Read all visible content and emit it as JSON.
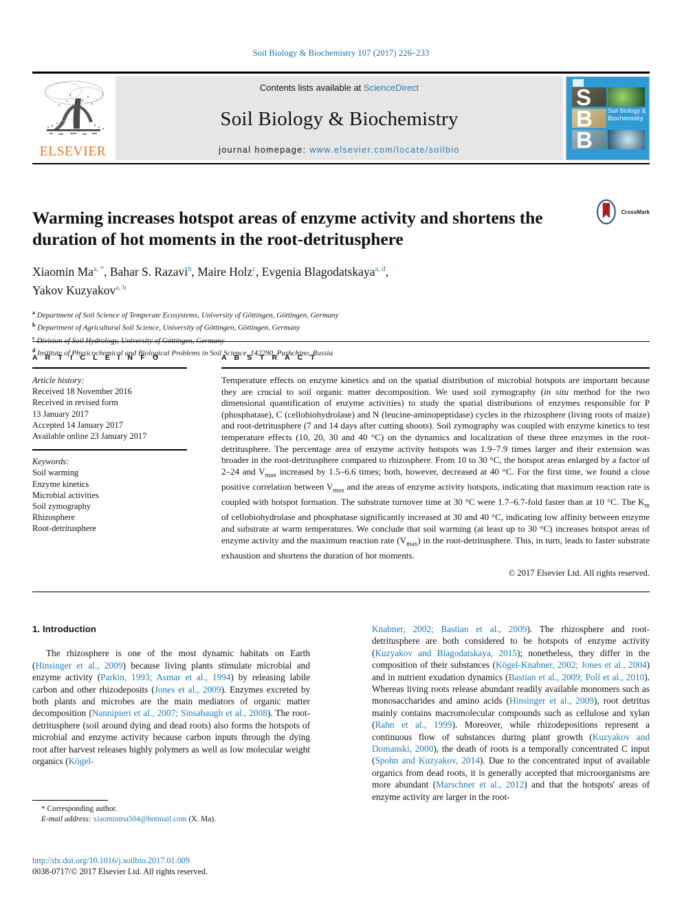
{
  "running_head": "Soil Biology & Biochemistry 107 (2017) 226–233",
  "masthead": {
    "contents_prefix": "Contents lists available at ",
    "sciencedirect": "ScienceDirect",
    "journal_title": "Soil Biology & Biochemistry",
    "homepage_prefix": "journal homepage: ",
    "homepage_url": "www.elsevier.com/locate/soilbio",
    "publisher": "ELSEVIER",
    "cover": {
      "letters": [
        "S",
        "B",
        "B"
      ],
      "title_line1": "Soil Biology &",
      "title_line2": "Biochemistry"
    }
  },
  "article": {
    "title": "Warming increases hotspot areas of enzyme activity and shortens the duration of hot moments in the root-detritusphere",
    "crossmark_label": "CrossMark",
    "authors_line1_parts": [
      {
        "name": "Xiaomin Ma",
        "sup": "a, *"
      },
      {
        "name": "Bahar S. Razavi",
        "sup": "b"
      },
      {
        "name": "Maire Holz",
        "sup": "c"
      },
      {
        "name": "Evgenia Blagodatskaya",
        "sup": "a, d"
      }
    ],
    "authors_line2_parts": [
      {
        "name": "Yakov Kuzyakov",
        "sup": "a, b"
      }
    ],
    "affiliations": [
      {
        "mark": "a",
        "text": "Department of Soil Science of Temperate Ecosystems, University of Göttingen, Göttingen, Germany"
      },
      {
        "mark": "b",
        "text": "Department of Agricultural Soil Science, University of Göttingen, Göttingen, Germany"
      },
      {
        "mark": "c",
        "text": "Division of Soil Hydrology, University of Göttingen, Germany"
      },
      {
        "mark": "d",
        "text": "Institute of Physicochemical and Biological Problems in Soil Science, 142290, Pushchino, Russia"
      }
    ]
  },
  "article_info": {
    "heading": "A R T I C L E  I N F O",
    "history_label": "Article history:",
    "history": [
      "Received 18 November 2016",
      "Received in revised form",
      "13 January 2017",
      "Accepted 14 January 2017",
      "Available online 23 January 2017"
    ],
    "keywords_label": "Keywords:",
    "keywords": [
      "Soil warming",
      "Enzyme kinetics",
      "Microbial activities",
      "Soil zymography",
      "Rhizosphere",
      "Root-detritusphere"
    ]
  },
  "abstract": {
    "heading": "A B S T R A C T",
    "paragraph": "Temperature effects on enzyme kinetics and on the spatial distribution of microbial hotspots are important because they are crucial to soil organic matter decomposition. We used soil zymography (in situ method for the two dimensional quantification of enzyme activities) to study the spatial distributions of enzymes responsible for P (phosphatase), C (cellobiohydrolase) and N (leucine-aminopeptidase) cycles in the rhizosphere (living roots of maize) and root-detritusphere (7 and 14 days after cutting shoots). Soil zymography was coupled with enzyme kinetics to test temperature effects (10, 20, 30 and 40 °C) on the dynamics and localization of these three enzymes in the root-detritusphere. The percentage area of enzyme activity hotspots was 1.9–7.9 times larger and their extension was broader in the root-detritusphere compared to rhizosphere. From 10 to 30 °C, the hotspot areas enlarged by a factor of 2–24 and Vmax increased by 1.5–6.6 times; both, however, decreased at 40 °C. For the first time, we found a close positive correlation between Vmax and the areas of enzyme activity hotspots, indicating that maximum reaction rate is coupled with hotspot formation. The substrate turnover time at 30 °C were 1.7–6.7-fold faster than at 10 °C. The Km of cellobiohydrolase and phosphatase significantly increased at 30 and 40 °C, indicating low affinity between enzyme and substrate at warm temperatures. We conclude that soil warming (at least up to 30 °C) increases hotspot areas of enzyme activity and the maximum reaction rate (Vmax) in the root-detritusphere. This, in turn, leads to faster substrate exhaustion and shortens the duration of hot moments.",
    "copyright": "© 2017 Elsevier Ltd. All rights reserved."
  },
  "introduction": {
    "heading": "1. Introduction",
    "left_paragraph": "The rhizosphere is one of the most dynamic habitats on Earth (Hinsinger et al., 2009) because living plants stimulate microbial and enzyme activity (Parkin, 1993; Asmar et al., 1994) by releasing labile carbon and other rhizodeposits (Jones et al., 2009). Enzymes excreted by both plants and microbes are the main mediators of organic matter decomposition (Nannipieri et al., 2007; Sinsabaugh et al., 2008). The root-detritusphere (soil around dying and dead roots) also forms the hotspots of microbial and enzyme activity because carbon inputs through the dying root after harvest releases highly polymers as well as low molecular weight organics (Kögel-",
    "right_paragraph": "Knabner, 2002; Bastian et al., 2009). The rhizosphere and root-detritusphere are both considered to be hotspots of enzyme activity (Kuzyakov and Blagodatskaya, 2015); nonetheless, they differ in the composition of their substances (Kögel-Knabner, 2002; Jones et al., 2004) and in nutrient exudation dynamics (Bastian et al., 2009; Poll et al., 2010). Whereas living roots release abundant readily available monomers such as monosaccharides and amino acids (Hinsinger et al., 2009), root detritus mainly contains macromolecular compounds such as cellulose and xylan (Rahn et al., 1999). Moreover, while rhizodepositions represent a continuous flow of substances during plant growth (Kuzyakov and Domanski, 2000), the death of roots is a temporally concentrated C input (Spohn and Kuzyakov, 2014). Due to the concentrated input of available organics from dead roots, it is generally accepted that microorganisms are more abundant (Marschner et al., 2012) and that the hotspots' areas of enzyme activity are larger in the root-"
  },
  "footnote": {
    "corresponding": "* Corresponding author.",
    "email_label": "E-mail address: ",
    "email": "xiaominma504@hotmail.com",
    "email_suffix": " (X. Ma)."
  },
  "footer": {
    "doi": "http://dx.doi.org/10.1016/j.soilbio.2017.01.009",
    "issn_line": "0038-0717/© 2017 Elsevier Ltd. All rights reserved."
  },
  "colors": {
    "link": "#1f7bb6",
    "accent_orange": "#E87722",
    "mast_bg": "#e6e6e6",
    "cover_blue": "#2e9ad6"
  }
}
